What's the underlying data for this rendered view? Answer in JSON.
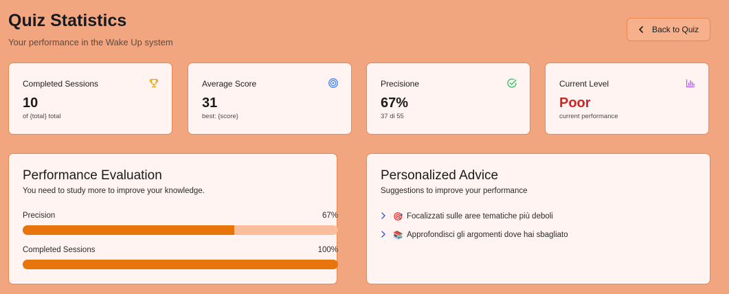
{
  "header": {
    "title": "Quiz Statistics",
    "subtitle": "Your performance in the Wake Up system",
    "back_label": "Back to Quiz"
  },
  "stats": [
    {
      "label": "Completed Sessions",
      "value": "10",
      "sub": "of {total} total",
      "icon": "trophy-icon",
      "icon_color": "#e5a00d"
    },
    {
      "label": "Average Score",
      "value": "31",
      "sub": "best: {score}",
      "icon": "target-icon",
      "icon_color": "#3b82f6"
    },
    {
      "label": "Precisione",
      "value": "67%",
      "sub": "37 di 55",
      "icon": "check-circle-icon",
      "icon_color": "#22c55e"
    },
    {
      "label": "Current Level",
      "value": "Poor",
      "sub": "current performance",
      "icon": "bar-chart-icon",
      "icon_color": "#a855f7",
      "value_color": "#c62828"
    }
  ],
  "evaluation": {
    "title": "Performance Evaluation",
    "description": "You need to study more to improve your knowledge.",
    "bars": [
      {
        "label": "Precision",
        "value_text": "67%",
        "fraction": 0.67
      },
      {
        "label": "Completed Sessions",
        "value_text": "100%",
        "fraction": 1.0
      }
    ]
  },
  "advice": {
    "title": "Personalized Advice",
    "description": "Suggestions to improve your performance",
    "items": [
      {
        "emoji": "🎯",
        "text": "Focalizzati sulle aree tematiche più deboli"
      },
      {
        "emoji": "📚",
        "text": "Approfondisci gli argomenti dove hai sbagliato"
      }
    ]
  },
  "colors": {
    "background": "#f2a680",
    "accent": "#e8750c",
    "track": "#fbbe9c",
    "card": "#fff4f1"
  }
}
